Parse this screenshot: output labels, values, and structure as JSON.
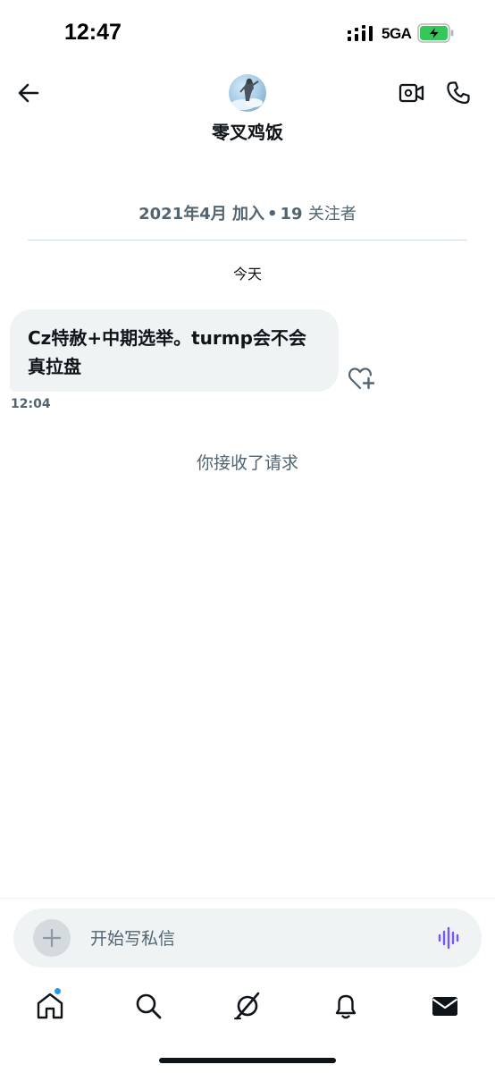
{
  "status_bar": {
    "time": "12:47",
    "network": "5GA",
    "icons": [
      "signal-icon",
      "battery-charging-icon"
    ]
  },
  "header": {
    "contact_name": "零叉鸡饭",
    "icons": [
      "back-arrow-icon",
      "video-camera-icon",
      "phone-icon"
    ]
  },
  "profile_info": {
    "joined": "2021年4月 加入",
    "separator": "•",
    "followers_count": "19",
    "followers_label": "关注者"
  },
  "conversation": {
    "date_label": "今天",
    "messages": [
      {
        "text": "Cz特赦+中期选举。turmp会不会真拉盘",
        "time": "12:04"
      }
    ],
    "request_notice": "你接收了请求"
  },
  "composer": {
    "placeholder": "开始写私信",
    "icons": [
      "plus-icon",
      "voice-waveform-icon"
    ]
  },
  "tab_bar": {
    "tabs": [
      "home",
      "search",
      "grok",
      "notifications",
      "messages"
    ],
    "active": "messages",
    "home_has_badge": true
  },
  "colors": {
    "accent": "#1d9bf0",
    "secondary_text": "#536471",
    "bubble": "#eff3f4",
    "voice_icon": "#7856ff"
  }
}
